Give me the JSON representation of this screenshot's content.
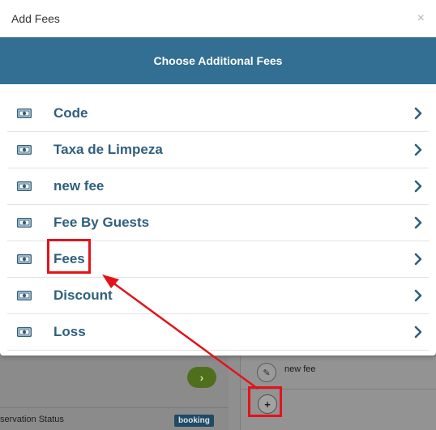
{
  "modal": {
    "title": "Add Fees",
    "close_icon": "close-icon",
    "banner_title": "Choose Additional Fees",
    "fees": [
      {
        "label": "Code"
      },
      {
        "label": "Taxa de Limpeza"
      },
      {
        "label": "new fee"
      },
      {
        "label": "Fee By Guests"
      },
      {
        "label": "Fees"
      },
      {
        "label": "Discount"
      },
      {
        "label": "Loss"
      }
    ]
  },
  "background": {
    "status_label": "servation Status",
    "status_badge": "booking",
    "fee_name": "new fee",
    "add_symbol": "+"
  },
  "colors": {
    "banner": "#336f92",
    "fee_text": "#2f5f7e",
    "highlight": "#e3131b"
  }
}
